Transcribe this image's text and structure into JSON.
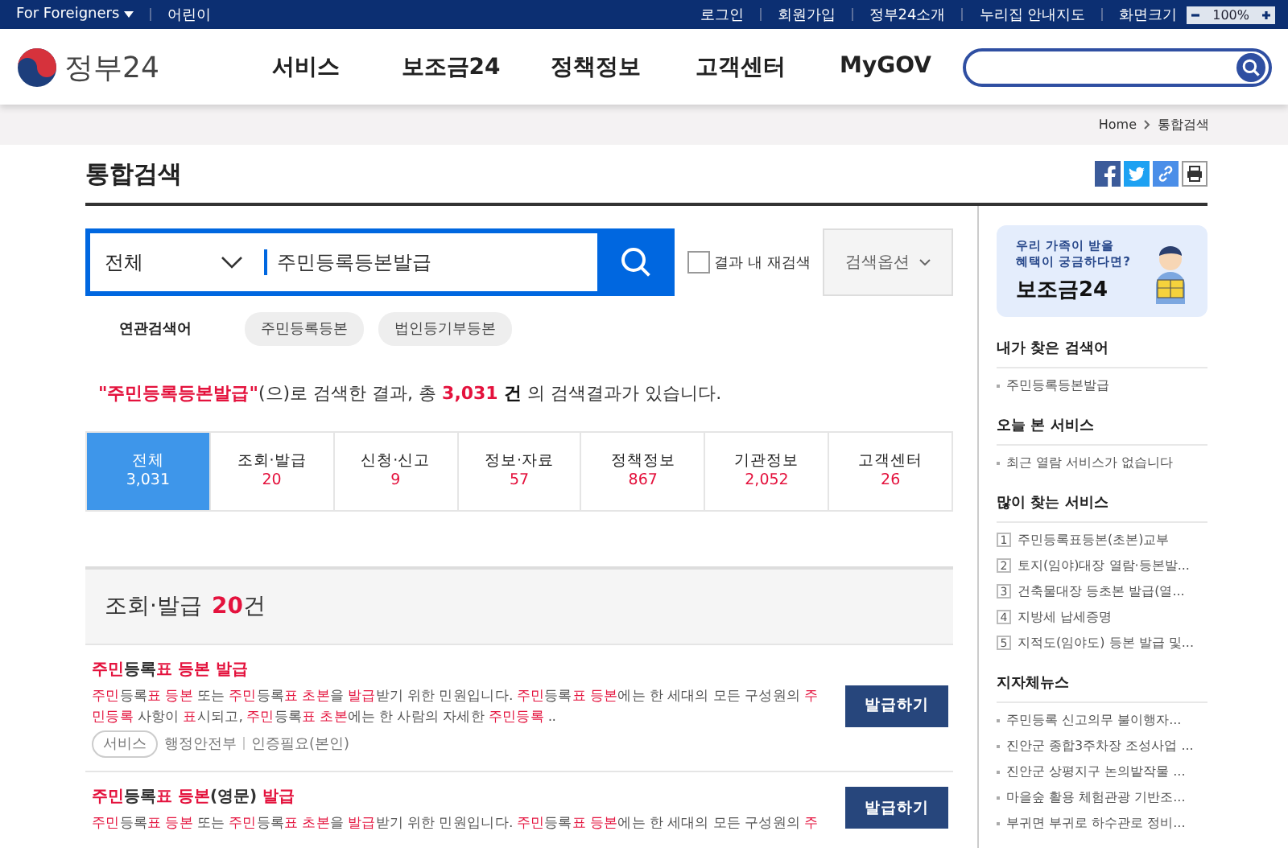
{
  "top_bar": {
    "language_menu": "For Foreigners",
    "links_left": [
      "어린이"
    ],
    "links_right": [
      "로그인",
      "회원가입",
      "정부24소개",
      "누리집 안내지도"
    ],
    "zoom": {
      "label": "화면크기",
      "value": "100%"
    }
  },
  "header": {
    "logo": "정부24",
    "nav": [
      "서비스",
      "보조금24",
      "정책정보",
      "고객센터",
      "MyGOV"
    ]
  },
  "breadcrumb": [
    "Home",
    "통합검색"
  ],
  "page_title": "통합검색",
  "search": {
    "scope": "전체",
    "query": "주민등록등본발급",
    "refine": {
      "label": "결과 내 재검색",
      "checked": false
    },
    "options_button": "검색옵션"
  },
  "related": {
    "label": "연관검색어",
    "keywords": [
      "주민등록등본",
      "법인등기부등본"
    ]
  },
  "summary": [
    {
      "kind": "query",
      "text": "\"주민등록등본발급\""
    },
    {
      "kind": "plain",
      "text": "(으)로 검색한 결과, 총 "
    },
    {
      "kind": "count",
      "text": "3,031"
    },
    {
      "kind": "unit",
      "text": " 건"
    },
    {
      "kind": "plain",
      "text": " 의 검색결과가 있습니다."
    }
  ],
  "tabs": [
    {
      "label": "전체",
      "count": "3,031",
      "selected": true
    },
    {
      "label": "조회·발급",
      "count": "20",
      "selected": false
    },
    {
      "label": "신청·신고",
      "count": "9",
      "selected": false
    },
    {
      "label": "정보·자료",
      "count": "57",
      "selected": false
    },
    {
      "label": "정책정보",
      "count": "867",
      "selected": false
    },
    {
      "label": "기관정보",
      "count": "2,052",
      "selected": false
    },
    {
      "label": "고객센터",
      "count": "26",
      "selected": false
    }
  ],
  "section": {
    "title": "조회·발급",
    "count": "20",
    "unit": "건"
  },
  "results": [
    {
      "title": "**주민**등록**표 등본 발급**",
      "description": "**주민**등록**표 등본** 또는 **주민**등록**표 초본**을 **발급**받기 위한 민원입니다. **주민**등록**표 등본**에는 한 세대의 모든 구성원의 **주민등록** 사항이 **표**시되고, **주민**등록**표 초본**에는 한 사람의 자세한 **주민등록** ..",
      "tag": "서비스",
      "agency": "행정안전부",
      "note": "인증필요(본인)",
      "button": "발급하기"
    },
    {
      "title": "**주민**등록**표 등본**(영문) **발급**",
      "description": "**주민**등록**표 등본** 또는 **주민**등록**표 초본**을 **발급**받기 위한 민원입니다. **주민**등록**표 등본**에는 한 세대의 모든 구성원의 **주**",
      "button": "발급하기"
    }
  ],
  "sidebar": {
    "banner": {
      "line1": "우리 가족이 받을",
      "line2": "혜택이 궁금하다면?",
      "title": "보조금24"
    },
    "sections": [
      {
        "title": "내가 찾은 검색어",
        "kind": "plain",
        "items": [
          {
            "text": "주민등록등본발급"
          }
        ]
      },
      {
        "title": "오늘 본 서비스",
        "kind": "plain",
        "items": [
          {
            "text": "최근 열람 서비스가 없습니다"
          }
        ]
      },
      {
        "title": "많이 찾는 서비스",
        "kind": "ranked",
        "items": [
          {
            "rank": "1",
            "text": "주민등록표등본(초본)교부"
          },
          {
            "rank": "2",
            "text": "토지(임야)대장 열람·등본발..."
          },
          {
            "rank": "3",
            "text": "건축물대장 등초본 발급(열..."
          },
          {
            "rank": "4",
            "text": "지방세 납세증명"
          },
          {
            "rank": "5",
            "text": "지적도(임야도) 등본 발급 및..."
          }
        ]
      },
      {
        "title": "지자체뉴스",
        "kind": "plain",
        "items": [
          {
            "text": "주민등록 신고의무 불이행자..."
          },
          {
            "text": "진안군 종합3주차장 조성사업 ..."
          },
          {
            "text": "진안군 상평지구 논의밭작물 ..."
          },
          {
            "text": "마을숲 활용 체험관광 기반조..."
          },
          {
            "text": "부귀면 부귀로 하수관로 정비..."
          }
        ]
      }
    ]
  }
}
